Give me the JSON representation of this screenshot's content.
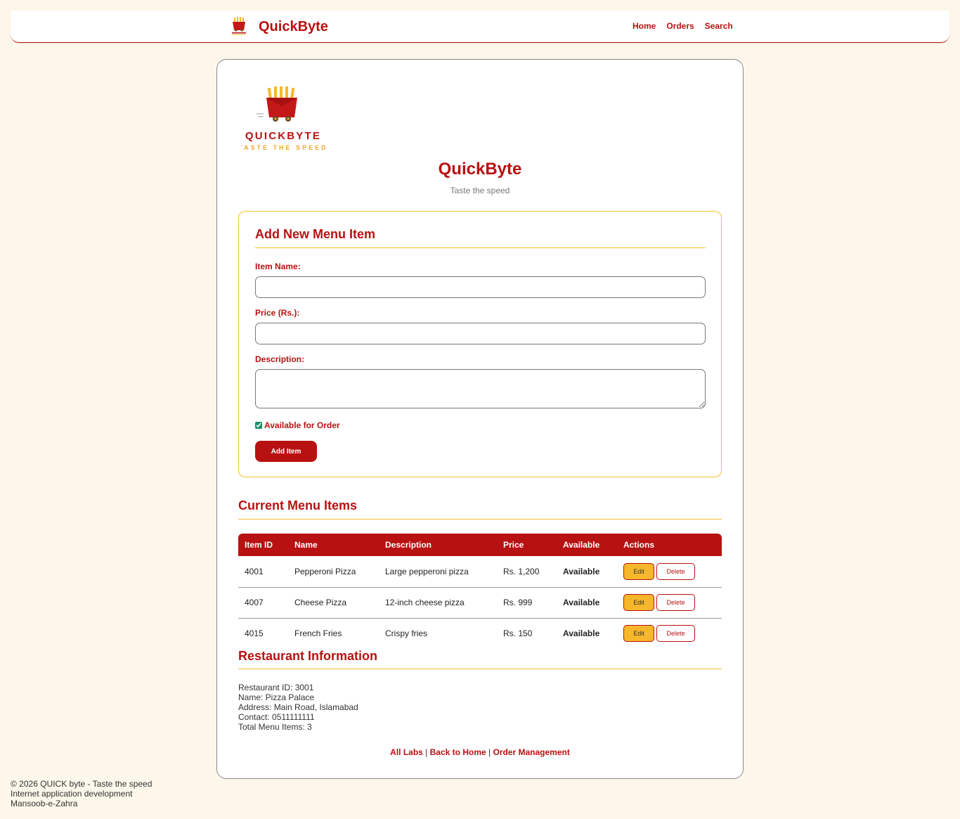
{
  "nav": {
    "brand": "QuickByte",
    "links": [
      "Home",
      "Orders",
      "Search"
    ]
  },
  "hero": {
    "logo_text": "QUICKBYTE",
    "logo_tagline": "TASTE THE SPEED",
    "title": "QuickByte",
    "tagline": "Taste the speed"
  },
  "form": {
    "title": "Add New Menu Item",
    "item_name_label": "Item Name:",
    "item_name_value": "",
    "price_label": "Price (Rs.):",
    "price_value": "",
    "description_label": "Description:",
    "description_value": "",
    "available_label": "Available for Order",
    "available_checked": true,
    "submit_label": "Add Item"
  },
  "menu": {
    "title": "Current Menu Items",
    "headers": [
      "Item ID",
      "Name",
      "Description",
      "Price",
      "Available",
      "Actions"
    ],
    "rows": [
      {
        "id": "4001",
        "name": "Pepperoni Pizza",
        "description": "Large pepperoni pizza",
        "price": "Rs. 1,200",
        "available": "Available",
        "edit": "Edit",
        "delete": "Delete"
      },
      {
        "id": "4007",
        "name": "Cheese Pizza",
        "description": "12-inch cheese pizza",
        "price": "Rs. 999",
        "available": "Available",
        "edit": "Edit",
        "delete": "Delete"
      },
      {
        "id": "4015",
        "name": "French Fries",
        "description": "Crispy fries",
        "price": "Rs. 150",
        "available": "Available",
        "edit": "Edit",
        "delete": "Delete"
      }
    ]
  },
  "restaurant": {
    "title": "Restaurant Information",
    "lines": [
      "Restaurant ID: 3001",
      "Name: Pizza Palace",
      "Address: Main Road, Islamabad",
      "Contact: 0511111111",
      "Total Menu Items: 3"
    ]
  },
  "footer_links": {
    "all_labs": "All Labs",
    "sep1": " | ",
    "back_home": "Back to Home",
    "sep2": " | ",
    "order_mgmt": "Order Management"
  },
  "page_footer": {
    "lines": [
      "© 2026 QUICK byte - Taste the speed",
      "Internet application development",
      "Mansoob-e-Zahra"
    ]
  },
  "colors": {
    "brand_red": "#b81111",
    "accent_yellow": "#f0c230",
    "available_green": "#2a9a2a",
    "background": "#fcf7ea"
  }
}
